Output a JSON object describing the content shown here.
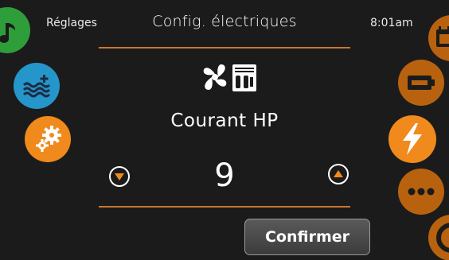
{
  "header": {
    "section": "Réglages",
    "title": "Config. électriques",
    "time": "8:01am"
  },
  "setting": {
    "label": "Courant HP",
    "value": "9"
  },
  "actions": {
    "confirm_label": "Confirmer"
  },
  "colors": {
    "accent_orange": "#f08a1c",
    "dim_orange": "#b8620f",
    "water_blue": "#2596c9",
    "music_green": "#2e9e3a",
    "rule": "#c8772e",
    "background": "#1b1b1b"
  },
  "left_menu": [
    "music-icon",
    "water-waves-icon",
    "settings-gears-icon"
  ],
  "right_menu": [
    "calendar-icon",
    "battery-icon",
    "lightning-icon",
    "more-icon",
    "power-icon"
  ]
}
